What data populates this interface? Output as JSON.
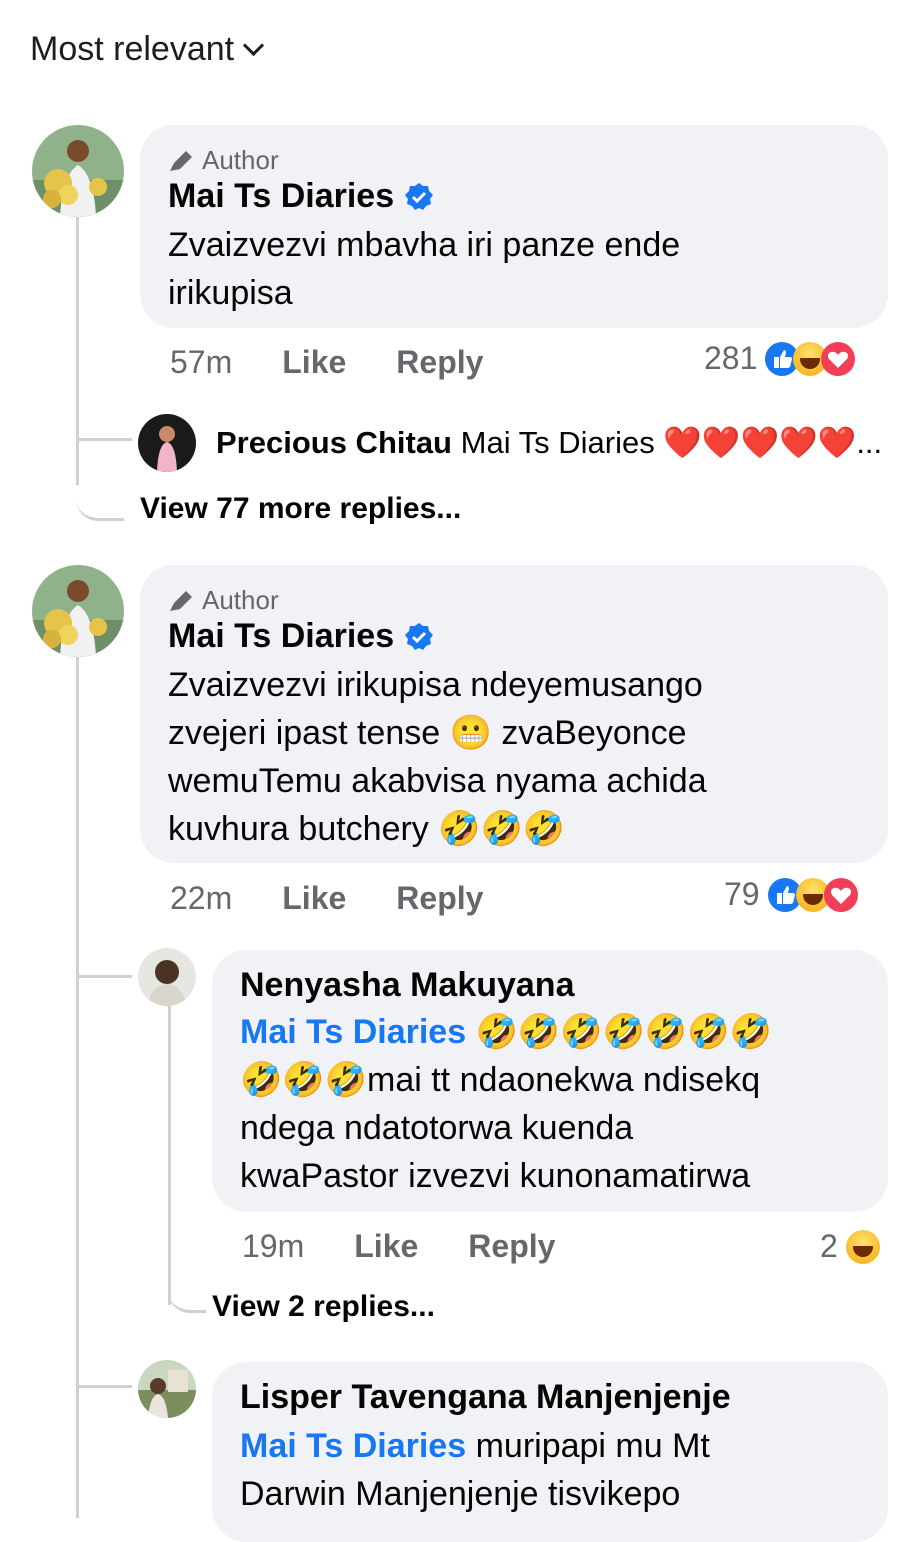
{
  "sort": {
    "label": "Most relevant"
  },
  "comments": [
    {
      "author_tag": "Author",
      "name": "Mai Ts Diaries",
      "text_lines": [
        "Zvaizvezvi mbavha iri panze ende",
        "irikupisa"
      ],
      "time": "57m",
      "like_label": "Like",
      "reply_label": "Reply",
      "reaction_count": "281",
      "reply_preview": {
        "name": "Precious Chitau",
        "text": "Mai Ts Diaries ❤️❤️❤️❤️❤️..."
      },
      "view_more": "View 77 more replies..."
    },
    {
      "author_tag": "Author",
      "name": "Mai Ts Diaries",
      "text_lines": [
        "Zvaizvezvi irikupisa ndeyemusango",
        "zvejeri ipast tense 😬 zvaBeyonce",
        "wemuTemu akabvisa nyama achida",
        "kuvhura butchery 🤣🤣🤣"
      ],
      "time": "22m",
      "like_label": "Like",
      "reply_label": "Reply",
      "reaction_count": "79"
    }
  ],
  "replies": [
    {
      "name": "Nenyasha Makuyana",
      "mention": "Mai Ts Diaries",
      "line1_suffix": " 🤣🤣🤣🤣🤣🤣🤣",
      "text_lines": [
        "🤣🤣🤣mai tt ndaonekwa ndisekq",
        "ndega ndatotorwa kuenda",
        "kwaPastor izvezvi kunonamatirwa"
      ],
      "time": "19m",
      "like_label": "Like",
      "reply_label": "Reply",
      "reaction_count": "2",
      "view_more": "View 2 replies..."
    },
    {
      "name": "Lisper Tavengana Manjenjenje",
      "mention": "Mai Ts Diaries",
      "line1_suffix": " muripapi  mu Mt",
      "text_lines": [
        "Darwin Manjenjenje tisvikepo"
      ]
    }
  ],
  "colors": {
    "bubble": "#f0f2f5",
    "link": "#1877f2",
    "muted": "#65676b",
    "heart": "#f33e58"
  }
}
